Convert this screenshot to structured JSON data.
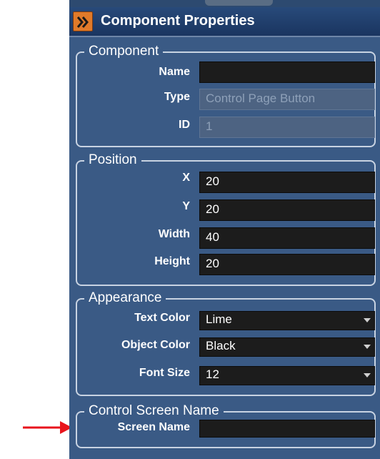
{
  "panel": {
    "title": "Component Properties",
    "collapse_icon": "chevron-double-right-icon",
    "accent": "#e07a2a",
    "background": "#3a5a85"
  },
  "component": {
    "legend": "Component",
    "name_label": "Name",
    "name_value": "",
    "type_label": "Type",
    "type_value": "Control Page Button",
    "id_label": "ID",
    "id_value": "1"
  },
  "position": {
    "legend": "Position",
    "x_label": "X",
    "x_value": "20",
    "y_label": "Y",
    "y_value": "20",
    "width_label": "Width",
    "width_value": "40",
    "height_label": "Height",
    "height_value": "20"
  },
  "appearance": {
    "legend": "Appearance",
    "text_color_label": "Text Color",
    "text_color_value": "Lime",
    "object_color_label": "Object Color",
    "object_color_value": "Black",
    "font_size_label": "Font Size",
    "font_size_value": "12"
  },
  "control_screen": {
    "legend": "Control Screen Name",
    "screen_name_label": "Screen Name",
    "screen_name_value": ""
  },
  "annotation": {
    "arrow_color": "#e8141c"
  }
}
